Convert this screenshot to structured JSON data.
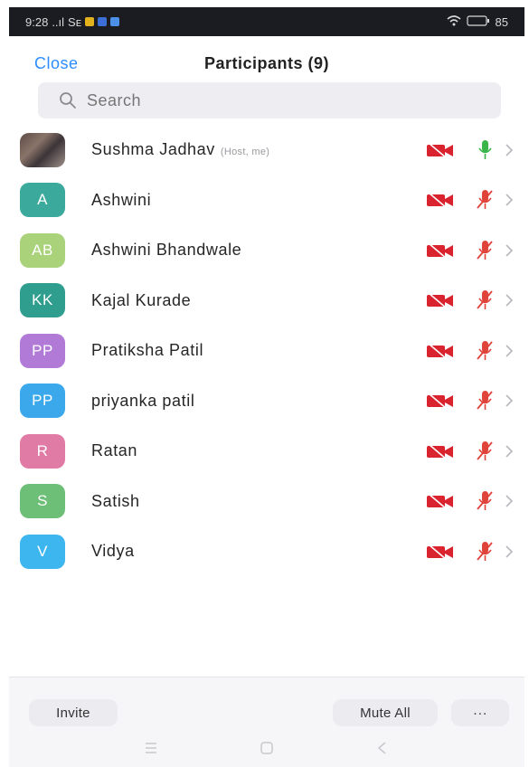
{
  "status_bar": {
    "time": "9:28",
    "signal": "..ıl",
    "network": "Sᴇ",
    "battery": "85"
  },
  "header": {
    "close_label": "Close",
    "title": "Participants (9)"
  },
  "search": {
    "placeholder": "Search",
    "icon": "search-icon"
  },
  "participants": [
    {
      "name": "Sushma Jadhav",
      "role": "(Host, me)",
      "initials": "",
      "avatar_color": "",
      "photo": true,
      "video": "off",
      "mic": "on"
    },
    {
      "name": "Ashwini",
      "initials": "A",
      "avatar_color": "#3ba99c",
      "video": "off",
      "mic": "muted"
    },
    {
      "name": "Ashwini Bhandwale",
      "initials": "AB",
      "avatar_color": "#a9d27a",
      "video": "off",
      "mic": "muted"
    },
    {
      "name": "Kajal Kurade",
      "initials": "KK",
      "avatar_color": "#2f9e8e",
      "video": "off",
      "mic": "muted"
    },
    {
      "name": "Pratiksha Patil",
      "initials": "PP",
      "avatar_color": "#b07ad6",
      "video": "off",
      "mic": "muted"
    },
    {
      "name": "priyanka patil",
      "initials": "PP",
      "avatar_color": "#3aa8ea",
      "video": "off",
      "mic": "muted"
    },
    {
      "name": "Ratan",
      "initials": "R",
      "avatar_color": "#e07ba6",
      "video": "off",
      "mic": "muted"
    },
    {
      "name": "Satish",
      "initials": "S",
      "avatar_color": "#6dbf78",
      "video": "off",
      "mic": "muted"
    },
    {
      "name": "Vidya",
      "initials": "V",
      "avatar_color": "#3db6f0",
      "video": "off",
      "mic": "muted"
    }
  ],
  "footer": {
    "invite_label": "Invite",
    "mute_all_label": "Mute All",
    "more_label": "···"
  },
  "colors": {
    "accent": "#2d8cff",
    "video_off": "#d9232e",
    "mic_muted": "#e0433a",
    "mic_on": "#3ab54a"
  }
}
